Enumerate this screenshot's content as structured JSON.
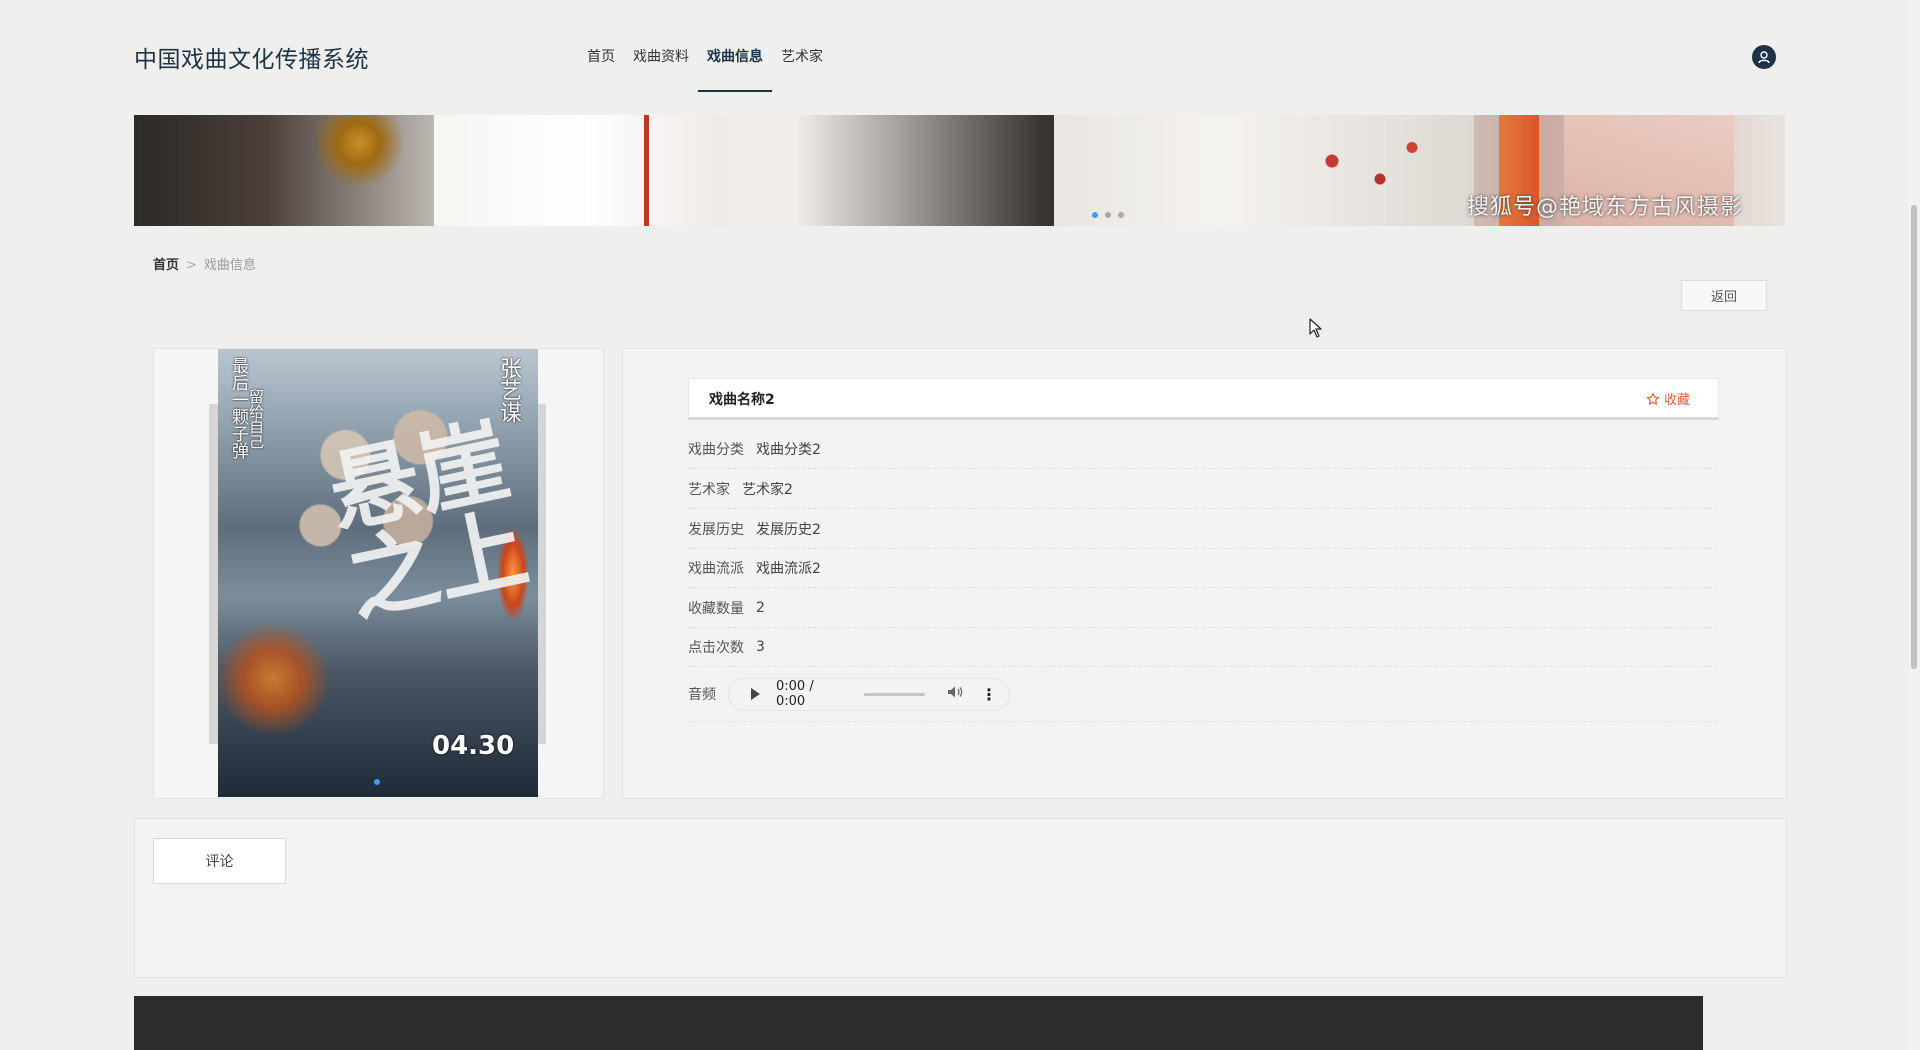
{
  "header": {
    "title": "中国戏曲文化传播系统",
    "nav": [
      {
        "label": "首页",
        "active": false
      },
      {
        "label": "戏曲资料",
        "active": false
      },
      {
        "label": "戏曲信息",
        "active": true
      },
      {
        "label": "艺术家",
        "active": false
      }
    ],
    "avatar_icon": "user-icon"
  },
  "banner": {
    "watermark": "搜狐号@艳域东方古风摄影",
    "slide_count": 3,
    "active_slide": 1
  },
  "breadcrumb": {
    "home": "首页",
    "separator": ">",
    "current": "戏曲信息"
  },
  "back_button": "返回",
  "poster": {
    "vertical_text_1": "最后一颗子弹",
    "vertical_text_2": "留给自己",
    "director": "张艺谋",
    "calligraphy": "悬崖之上",
    "date": "04.30"
  },
  "detail": {
    "name": "戏曲名称2",
    "favorite_label": "收藏",
    "favorite_icon": "star-icon",
    "fields": [
      {
        "label": "戏曲分类",
        "value": "戏曲分类2"
      },
      {
        "label": "艺术家",
        "value": "艺术家2"
      },
      {
        "label": "发展历史",
        "value": "发展历史2"
      },
      {
        "label": "戏曲流派",
        "value": "戏曲流派2"
      },
      {
        "label": "收藏数量",
        "value": "2"
      },
      {
        "label": "点击次数",
        "value": "3"
      }
    ],
    "audio": {
      "label": "音频",
      "time": "0:00 / 0:00",
      "volume_icon": "volume-icon",
      "more_icon": "more-vertical-icon"
    }
  },
  "comments": {
    "tab_label": "评论"
  },
  "colors": {
    "accent": "#1f3347",
    "favorite": "#e0603a",
    "active_dot": "#409eff",
    "footer": "#2c2c2c"
  }
}
